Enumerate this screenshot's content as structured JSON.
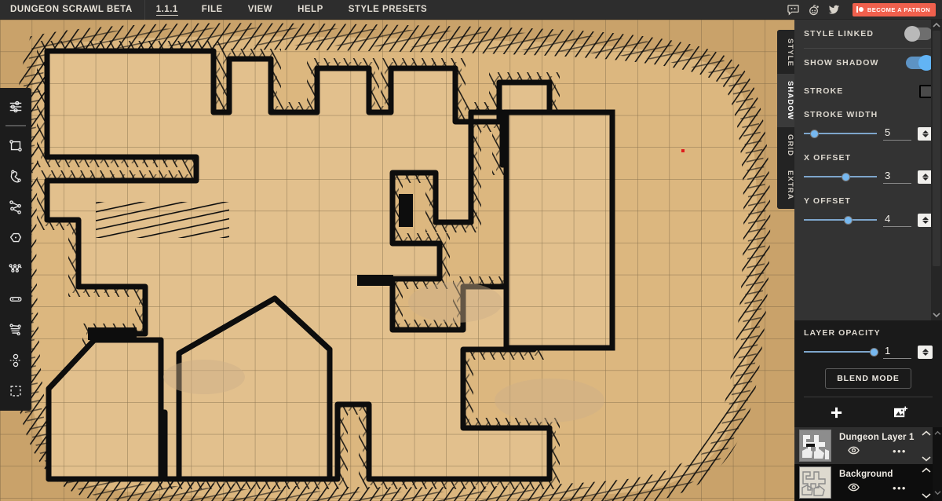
{
  "menubar": {
    "brand": "DUNGEON SCRAWL BETA",
    "version": "1.1.1",
    "items": [
      {
        "label": "FILE",
        "name": "menu-file"
      },
      {
        "label": "VIEW",
        "name": "menu-view"
      },
      {
        "label": "HELP",
        "name": "menu-help"
      },
      {
        "label": "STYLE PRESETS",
        "name": "menu-style-presets"
      }
    ],
    "social": [
      {
        "icon": "discord-icon"
      },
      {
        "icon": "reddit-icon"
      },
      {
        "icon": "twitter-icon"
      }
    ],
    "patron_label": "BECOME A PATRON"
  },
  "toolbar": {
    "tools": [
      {
        "name": "tool-settings",
        "icon": "sliders-icon"
      },
      {
        "name": "tool-rectangle",
        "icon": "rectangle-icon"
      },
      {
        "name": "tool-freehand",
        "icon": "blob-icon"
      },
      {
        "name": "tool-path",
        "icon": "polyline-icon"
      },
      {
        "name": "tool-polygon",
        "icon": "polygon-icon"
      },
      {
        "name": "tool-corridor",
        "icon": "branching-icon"
      },
      {
        "name": "tool-door",
        "icon": "door-icon"
      },
      {
        "name": "tool-stairs",
        "icon": "stairs-icon"
      },
      {
        "name": "tool-pillars",
        "icon": "pillars-icon"
      },
      {
        "name": "tool-select",
        "icon": "marquee-select-icon"
      }
    ]
  },
  "vertical_tabs": [
    {
      "label": "STYLE",
      "active": false
    },
    {
      "label": "SHADOW",
      "active": true
    },
    {
      "label": "GRID",
      "active": false
    },
    {
      "label": "EXTRA",
      "active": false
    }
  ],
  "shadow_panel": {
    "style_linked": {
      "label": "STYLE LINKED",
      "on": false
    },
    "show_shadow": {
      "label": "SHOW SHADOW",
      "on": true
    },
    "stroke": {
      "label": "STROKE",
      "color": "#4a4a4a"
    },
    "stroke_width": {
      "label": "STROKE WIDTH",
      "value": "5",
      "percent": 14
    },
    "x_offset": {
      "label": "X OFFSET",
      "value": "3",
      "percent": 57
    },
    "y_offset": {
      "label": "Y OFFSET",
      "value": "4",
      "percent": 60
    }
  },
  "layer_opacity": {
    "label": "LAYER OPACITY",
    "value": "1",
    "percent": 100,
    "blend_mode_label": "BLEND MODE",
    "add_layer_icon": "plus-icon",
    "add_image_icon": "add-image-icon"
  },
  "layers": [
    {
      "name": "Dungeon Layer 1",
      "selected": true,
      "visible": true,
      "visibility_icon": "eye-icon",
      "more_icon": "ellipsis-icon",
      "up_icon": "chevron-up-icon",
      "down_icon": "chevron-down-icon"
    },
    {
      "name": "Background",
      "selected": false,
      "visible": true,
      "visibility_icon": "eye-icon",
      "more_icon": "ellipsis-icon",
      "up_icon": "chevron-up-icon",
      "down_icon": "chevron-down-icon"
    }
  ],
  "canvas": {
    "floor_color": "#e2c08d",
    "wall_color": "#0d0d0d",
    "rock_color": "#c9a26a",
    "grid_color": "#6d5a3d",
    "cursor_marker_color": "#e01b1b"
  }
}
